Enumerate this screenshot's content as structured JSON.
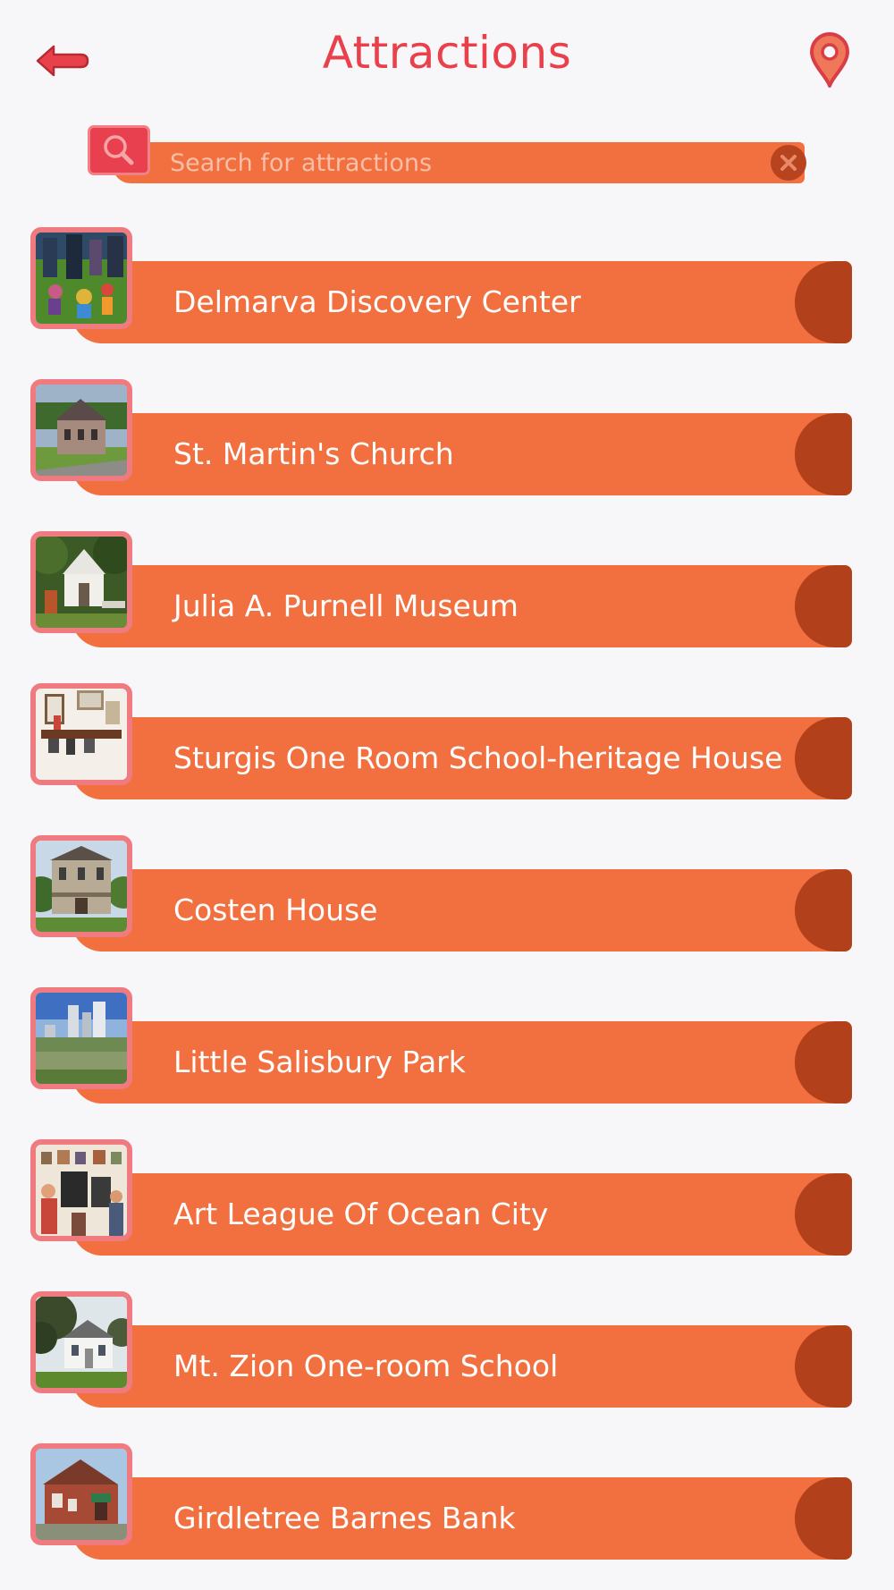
{
  "header": {
    "title": "Attractions",
    "back_icon": "back-arrow-icon",
    "map_icon": "location-pin-icon"
  },
  "search": {
    "placeholder": "Search for attractions",
    "value": "",
    "search_icon": "magnifier-icon",
    "clear_icon": "close-icon"
  },
  "colors": {
    "accent": "#e8414b",
    "bar": "#f2703f",
    "bar_cap": "#b2401b",
    "thumb_border": "#ef7a7f",
    "background": "#f7f7f9"
  },
  "attractions": [
    {
      "name": "Delmarva Discovery Center",
      "thumb": "kids-outdoor-photo"
    },
    {
      "name": "St. Martin's Church",
      "thumb": "old-church-photo"
    },
    {
      "name": "Julia A. Purnell Museum",
      "thumb": "white-chapel-photo"
    },
    {
      "name": "Sturgis One Room School-heritage House",
      "thumb": "interior-mantel-photo"
    },
    {
      "name": "Costen House",
      "thumb": "victorian-house-photo"
    },
    {
      "name": "Little Salisbury Park",
      "thumb": "park-river-photo"
    },
    {
      "name": "Art League Of Ocean City",
      "thumb": "gallery-crowd-photo"
    },
    {
      "name": "Mt. Zion One-room School",
      "thumb": "white-schoolhouse-photo"
    },
    {
      "name": "Girdletree Barnes Bank",
      "thumb": "brick-bank-photo"
    }
  ]
}
